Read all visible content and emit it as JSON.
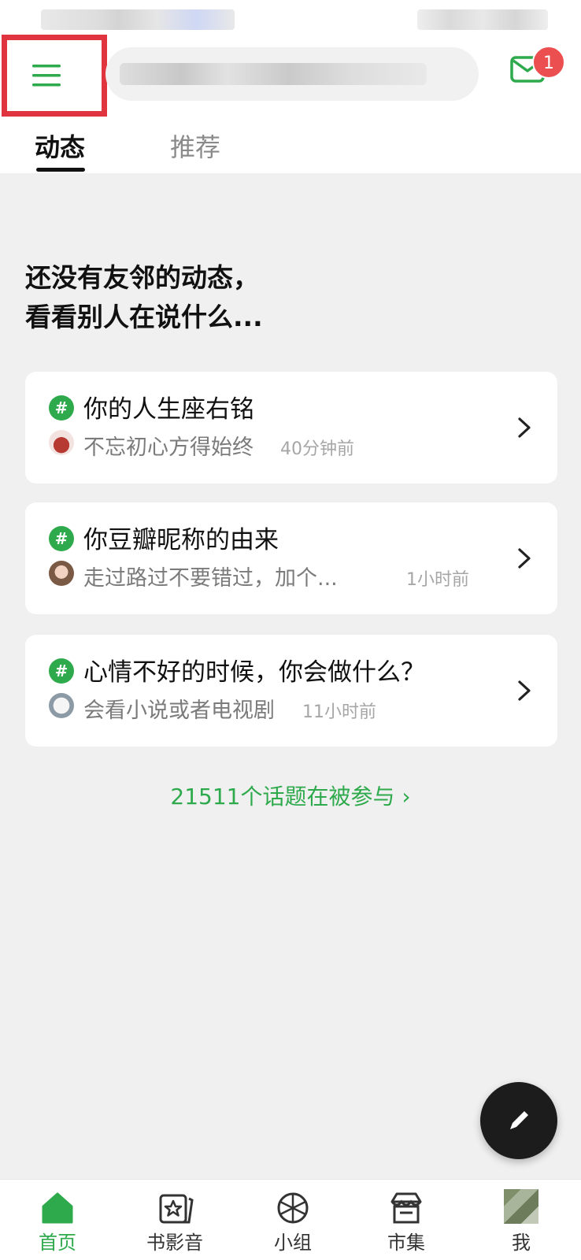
{
  "header": {
    "mail_badge_count": "1",
    "tabs": [
      {
        "label": "动态",
        "active": true
      },
      {
        "label": "推荐",
        "active": false
      }
    ]
  },
  "feed": {
    "empty_title_line1": "还没有友邻的动态，",
    "empty_title_line2": "看看别人在说什么...",
    "topics": [
      {
        "title": "你的人生座右铭",
        "subtitle": "不忘初心方得始终",
        "time": "40分钟前"
      },
      {
        "title": "你豆瓣昵称的由来",
        "subtitle": "走过路过不要错过，加个...",
        "time": "1小时前"
      },
      {
        "title": "心情不好的时候，你会做什么？",
        "subtitle": "会看小说或者电视剧",
        "time": "11小时前"
      }
    ],
    "topics_link": "21511个话题在被参与 ›"
  },
  "bottom_nav": [
    {
      "label": "首页",
      "icon": "home-icon",
      "active": true
    },
    {
      "label": "书影音",
      "icon": "star-card-icon",
      "active": false
    },
    {
      "label": "小组",
      "icon": "group-ball-icon",
      "active": false
    },
    {
      "label": "市集",
      "icon": "store-icon",
      "active": false
    },
    {
      "label": "我",
      "icon": "avatar",
      "active": false
    }
  ],
  "colors": {
    "accent": "#2eaa4c",
    "badge": "#ec4f4f",
    "highlight_box": "#e0343f",
    "background": "#f0f0f0"
  }
}
